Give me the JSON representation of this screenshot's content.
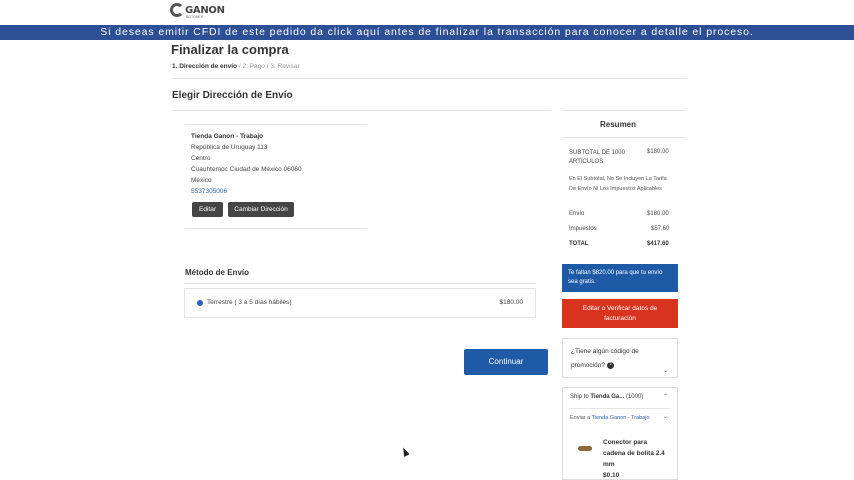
{
  "brand": {
    "name": "GANON",
    "sub": "BOTONES"
  },
  "banner": "Si deseas emitir CFDI de este pedido da click aquí antes de finalizar la transacción para conocer a detalle el proceso.",
  "page_title": "Finalizar la compra",
  "steps": [
    {
      "label": "1. Dirección de envío",
      "active": true
    },
    {
      "label": "2. Pago",
      "active": false
    },
    {
      "label": "3. Revisar",
      "active": false
    }
  ],
  "step_separator": "/",
  "section_title": "Elegir Dirección de Envío",
  "address": {
    "name": "Tienda Ganon - Trabajo",
    "line1": "República de Uruguay 113",
    "line2": "Centro",
    "line3": "Cuauhtemoc Ciudad de México 06060",
    "country": "México",
    "phone": "5537305006"
  },
  "buttons": {
    "edit": "Editar",
    "change_address": "Cambiar Dirección",
    "continue": "Continuar"
  },
  "shipping": {
    "title": "Método de Envío",
    "option_label": "Terrestre ( 3 a 5 días hábiles)",
    "option_price": "$180.00"
  },
  "summary": {
    "title": "Resumen",
    "subtotal_label": "SUBTOTAL DE 1000 ARTÍCULOS",
    "subtotal_value": "$180.00",
    "note": "En El Subtotal, No Se Incluyen La Tarifa De Envío Ni Los Impuestos Aplicables",
    "shipping_label": "Envío",
    "shipping_value": "$180.00",
    "taxes_label": "Impuestos",
    "taxes_value": "$57.60",
    "total_label": "TOTAL",
    "total_value": "$417.60"
  },
  "free_shipping_note": "Te faltan $820.00 para que tu envío sea gratis.",
  "billing_button": "Editar o Verificar datos de facturación",
  "promo": {
    "question": "¿Tiene algún código de promoción?",
    "help": "?"
  },
  "ship_to": {
    "prefix": "Ship to",
    "name": "Tienda Ga...",
    "count": "(1000)",
    "send_to_prefix": "Enviar a",
    "send_to_link": "Tienda Ganon - Trabajo"
  },
  "product": {
    "name": "Conector para cadena de bolita 2.4 mm",
    "price": "$0.10"
  },
  "icons": {
    "chevron_down": "chevron-down-icon",
    "chevron_up": "chevron-up-icon"
  },
  "colors": {
    "banner": "#2d4f96",
    "primary": "#1f5aa6",
    "danger": "#d7331e",
    "link": "#2a62b5"
  }
}
